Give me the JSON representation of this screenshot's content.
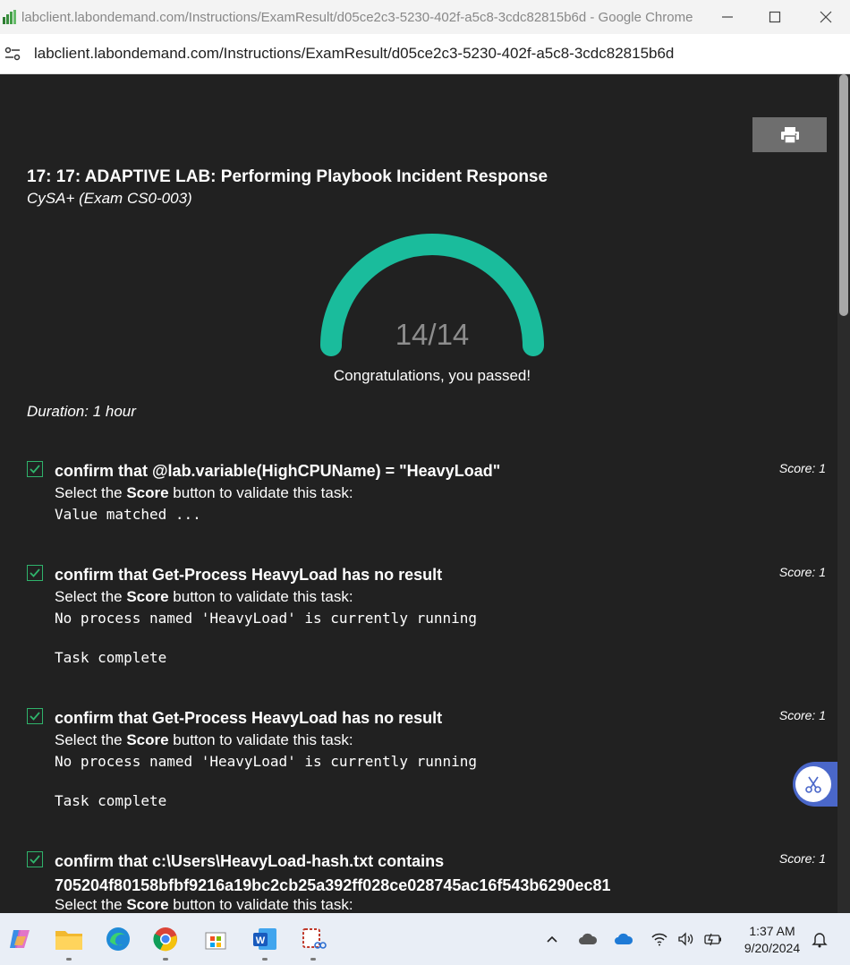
{
  "window": {
    "title": "labclient.labondemand.com/Instructions/ExamResult/d05ce2c3-5230-402f-a5c8-3cdc82815b6d - Google Chrome",
    "url": "labclient.labondemand.com/Instructions/ExamResult/d05ce2c3-5230-402f-a5c8-3cdc82815b6d"
  },
  "exam": {
    "title": "17: 17: ADAPTIVE LAB: Performing Playbook Incident Response",
    "subtitle": "CySA+ (Exam CS0-003)",
    "score": "14/14",
    "score_fraction": 1.0,
    "pass_message": "Congratulations, you passed!",
    "duration": "Duration: 1 hour",
    "accent_color": "#1abc9c"
  },
  "tasks": [
    {
      "title": "confirm that @lab.variable(HighCPUName) = \"HeavyLoad\"",
      "title_line2": "",
      "score": "Score: 1",
      "instr_pre": "Select the ",
      "instr_bold": "Score",
      "instr_post": " button to validate this task:",
      "output": "Value matched ..."
    },
    {
      "title": "confirm that Get-Process HeavyLoad has no result",
      "title_line2": "",
      "score": "Score: 1",
      "instr_pre": "Select the ",
      "instr_bold": "Score",
      "instr_post": " button to validate this task:",
      "output": "No process named 'HeavyLoad' is currently running\n\nTask complete"
    },
    {
      "title": "confirm that Get-Process HeavyLoad has no result",
      "title_line2": "",
      "score": "Score: 1",
      "instr_pre": "Select the ",
      "instr_bold": "Score",
      "instr_post": " button to validate this task:",
      "output": "No process named 'HeavyLoad' is currently running\n\nTask complete"
    },
    {
      "title": "confirm that c:\\Users\\HeavyLoad-hash.txt contains",
      "title_line2": "705204f80158bfbf9216a19bc2cb25a392ff028ce028745ac16f543b6290ec81",
      "score": "Score: 1",
      "instr_pre": "Select the ",
      "instr_bold": "Score",
      "instr_post": " button to validate this task:",
      "output": ""
    }
  ],
  "taskbar": {
    "time": "1:37 AM",
    "date": "9/20/2024",
    "apps": [
      "copilot-icon",
      "file-explorer-icon",
      "edge-icon",
      "chrome-icon",
      "store-icon",
      "word-icon",
      "snipping-tool-icon"
    ]
  }
}
